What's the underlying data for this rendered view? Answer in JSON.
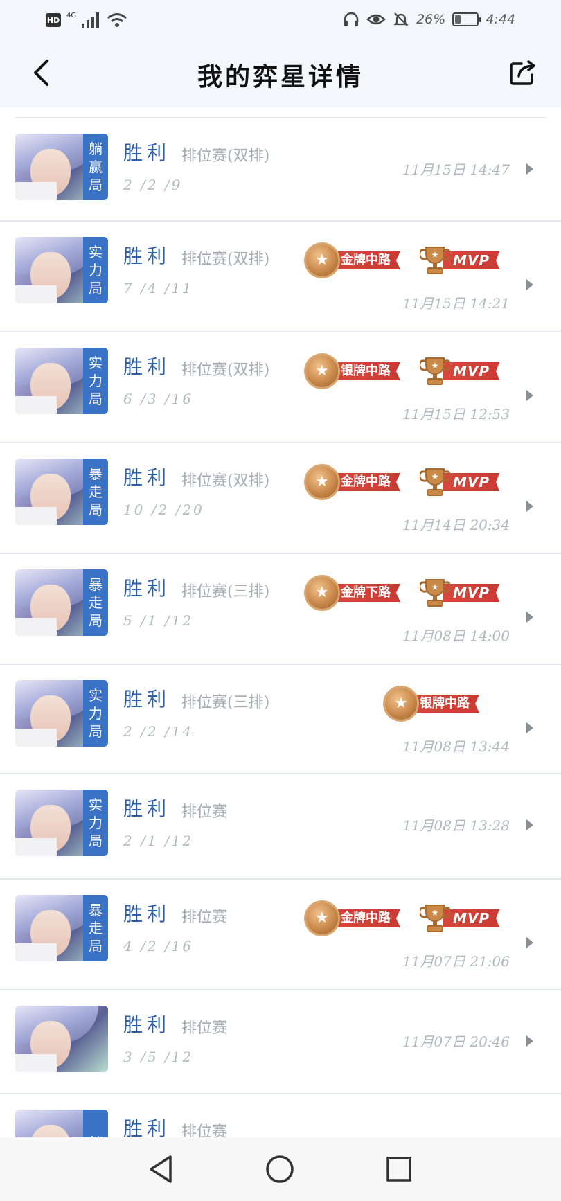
{
  "status_bar": {
    "hd": "HD",
    "network": "4G",
    "battery_percent": "26%",
    "battery_level": 0.26,
    "time": "4:44"
  },
  "header": {
    "title": "我的弈星详情",
    "back_icon": "chevron-left-icon",
    "share_icon": "share-icon"
  },
  "matches": [
    {
      "mode_tag": [
        "躺",
        "赢",
        "局"
      ],
      "result": "胜利",
      "type": "排位赛(双排)",
      "kda": "2 /2 /9",
      "time": "11月15日 14:47",
      "badges": []
    },
    {
      "mode_tag": [
        "实",
        "力",
        "局"
      ],
      "result": "胜利",
      "type": "排位赛(双排)",
      "kda": "7 /4 /11",
      "time": "11月15日 14:21",
      "badges": [
        {
          "label": "金牌中路",
          "kind": "medal"
        },
        {
          "label": "MVP",
          "kind": "mvp"
        }
      ]
    },
    {
      "mode_tag": [
        "实",
        "力",
        "局"
      ],
      "result": "胜利",
      "type": "排位赛(双排)",
      "kda": "6 /3 /16",
      "time": "11月15日 12:53",
      "badges": [
        {
          "label": "银牌中路",
          "kind": "medal"
        },
        {
          "label": "MVP",
          "kind": "mvp"
        }
      ]
    },
    {
      "mode_tag": [
        "暴",
        "走",
        "局"
      ],
      "result": "胜利",
      "type": "排位赛(双排)",
      "kda": "10 /2 /20",
      "time": "11月14日 20:34",
      "badges": [
        {
          "label": "金牌中路",
          "kind": "medal"
        },
        {
          "label": "MVP",
          "kind": "mvp"
        }
      ]
    },
    {
      "mode_tag": [
        "暴",
        "走",
        "局"
      ],
      "result": "胜利",
      "type": "排位赛(三排)",
      "kda": "5 /1 /12",
      "time": "11月08日 14:00",
      "badges": [
        {
          "label": "金牌下路",
          "kind": "medal"
        },
        {
          "label": "MVP",
          "kind": "mvp"
        }
      ]
    },
    {
      "mode_tag": [
        "实",
        "力",
        "局"
      ],
      "result": "胜利",
      "type": "排位赛(三排)",
      "kda": "2 /2 /14",
      "time": "11月08日 13:44",
      "badges": [
        {
          "label": "银牌中路",
          "kind": "medal"
        }
      ]
    },
    {
      "mode_tag": [
        "实",
        "力",
        "局"
      ],
      "result": "胜利",
      "type": "排位赛",
      "kda": "2 /1 /12",
      "time": "11月08日 13:28",
      "badges": []
    },
    {
      "mode_tag": [
        "暴",
        "走",
        "局"
      ],
      "result": "胜利",
      "type": "排位赛",
      "kda": "4 /2 /16",
      "time": "11月07日 21:06",
      "badges": [
        {
          "label": "金牌中路",
          "kind": "medal"
        },
        {
          "label": "MVP",
          "kind": "mvp"
        }
      ]
    },
    {
      "mode_tag": [],
      "result": "胜利",
      "type": "排位赛",
      "kda": "3 /5 /12",
      "time": "11月07日 20:46",
      "badges": []
    },
    {
      "mode_tag": [
        "躺"
      ],
      "result": "胜利",
      "type": "排位赛",
      "kda": "",
      "time": "",
      "badges": []
    }
  ],
  "colors": {
    "result_blue": "#2e5fa8",
    "mode_tag_blue": "#3a72c6",
    "badge_red": "#d7473d",
    "medal_gold": "#c9894b"
  },
  "nav": {
    "back_icon": "triangle-back-icon",
    "home_icon": "circle-home-icon",
    "recents_icon": "square-recents-icon"
  }
}
